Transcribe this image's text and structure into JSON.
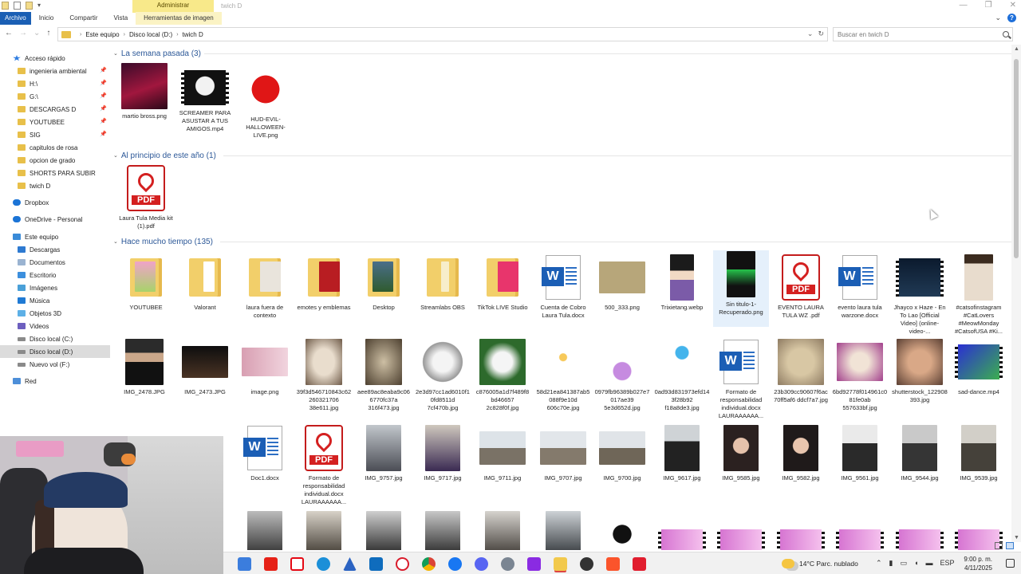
{
  "window": {
    "context_tab": "Administrar",
    "title": "twich D"
  },
  "ribbon": {
    "tabs": [
      "Archivo",
      "Inicio",
      "Compartir",
      "Vista",
      "Herramientas de imagen"
    ]
  },
  "address": {
    "crumbs": [
      "Este equipo",
      "Disco local (D:)",
      "twich D"
    ],
    "search_placeholder": "Buscar en twich D"
  },
  "sidebar": {
    "quick_access": "Acceso rápido",
    "pinned": [
      "ingenieria ambiental",
      "H:\\",
      "G:\\",
      "DESCARGAS D",
      "YOUTUBEE",
      "SIG"
    ],
    "folders": [
      "capitulos de rosa",
      "opcion de grado",
      "SHORTS PARA SUBIR",
      "twich D"
    ],
    "dropbox": "Dropbox",
    "onedrive": "OneDrive - Personal",
    "this_pc": "Este equipo",
    "pc_items": [
      "Descargas",
      "Documentos",
      "Escritorio",
      "Imágenes",
      "Música",
      "Objetos 3D",
      "Videos",
      "Disco local (C:)",
      "Disco local (D:)",
      "Nuevo vol (F:)"
    ],
    "network": "Red"
  },
  "groups": {
    "last_week": "La semana pasada (3)",
    "this_year": "Al principio de este año (1)",
    "long_ago": "Hace mucho tiempo (135)"
  },
  "files_last_week": [
    "martio bross.png",
    "SCREAMER PARA ASUSTAR A TUS AMIGOS.mp4",
    "HUD-EVIL-HALLOWEEN-LIVE.png"
  ],
  "files_this_year": [
    "Laura Tula Media kit (1).pdf"
  ],
  "files_row1": [
    "YOUTUBEE",
    "Valorant",
    "laura fuera de contexto",
    "emotes y emblemas",
    "Desktop",
    "Streamlabs OBS",
    "TikTok LIVE Studio",
    "Cuenta de Cobro Laura Tula.docx",
    "500_333.png",
    "Trixietang.webp",
    "Sin titulo-1-Recuperado.png",
    "EVENTO LAURA TULA WZ .pdf",
    "evento laura tula warzone.docx",
    "Jhayco x Haze - En To Lao [Official Video] (online-video-...",
    "#catsofinstagram #CatLovers #MeowMonday #CatsofUSA #Ki..."
  ],
  "files_row2": [
    "IMG_2478.JPG",
    "IMG_2473.JPG",
    "image.png",
    "39f3d546710843c62260321706 38e611.jpg",
    "aee89ac8eaba9c066770fc37a 316f473.jpg",
    "2e3d97cc1ad6010f10fd8511d 7cf470b.jpg",
    "c876005a1d7f489f8bd46657 2c828f0f.jpg",
    "58d21ea841387ab5088f9e10d 606c70e.jpg",
    "0979fb96389b027e7017ae39 5e3d652d.jpg",
    "0ad93d831973efd143f28b92 f18a8de3.jpg",
    "Formato de responsabilidad individual.docx LAURAAAAAA...",
    "23b309cc90607f6ac70ff5af6 ddcf7a7.jpg",
    "6bd92778f014961c081fe0ab 557633bf.jpg",
    "shutterstock_122908393.jpg",
    "sad-dance.mp4"
  ],
  "files_row3": [
    "Doc1.docx",
    "Formato de responsabilidad individual.docx LAURAAAAAA...",
    "IMG_9757.jpg",
    "IMG_9717.jpg",
    "IMG_9711.jpg",
    "IMG_9707.jpg",
    "IMG_9700.jpg",
    "IMG_9617.jpg",
    "IMG_9585.jpg",
    "IMG_9582.jpg",
    "IMG_9561.jpg",
    "IMG_9544.jpg",
    "IMG_9539.jpg"
  ],
  "taskbar": {
    "weather": "14°C  Parc. nublado",
    "lang": "ESP",
    "time": "9:00 p. m.",
    "date": "4/11/2025"
  },
  "colors": {
    "accent": "#1a5fb4",
    "group_header": "#2b5797",
    "context_tab": "#f8e98a"
  }
}
